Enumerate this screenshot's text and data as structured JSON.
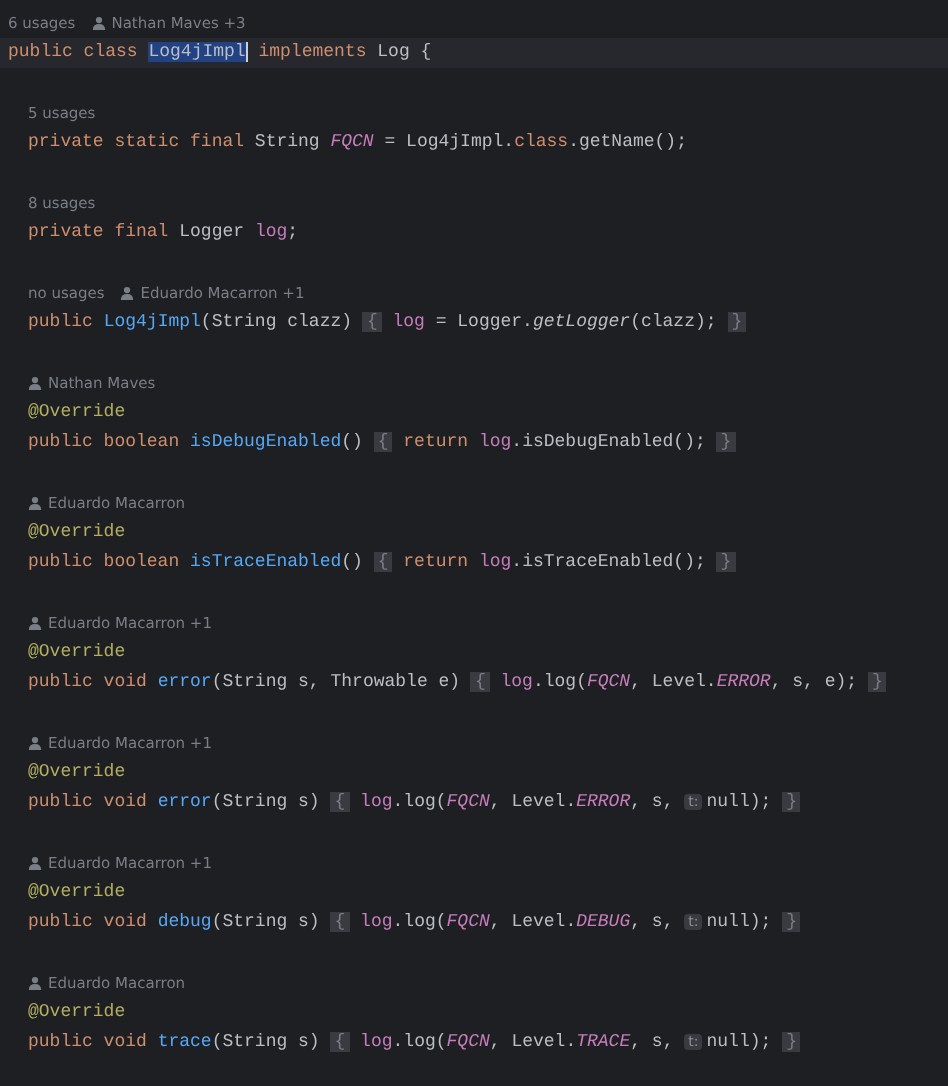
{
  "blocks": [
    {
      "usages": "6 usages",
      "author": "Nathan Maves +3",
      "indent": false,
      "current_line": true,
      "lines": [
        [
          {
            "text": "public class ",
            "kind": "kw"
          },
          {
            "text": "Log4jImpl",
            "kind": "selected"
          },
          {
            "text": " implements ",
            "kind": "kw"
          },
          {
            "text": "Log {",
            "kind": "plain"
          }
        ]
      ]
    },
    {
      "usages": "5 usages",
      "indent": true,
      "lines": [
        [
          {
            "text": "private static final ",
            "kind": "kw"
          },
          {
            "text": "String ",
            "kind": "plain"
          },
          {
            "text": "FQCN",
            "kind": "const"
          },
          {
            "text": " = Log4jImpl.",
            "kind": "plain"
          },
          {
            "text": "class",
            "kind": "kw"
          },
          {
            "text": ".getName();",
            "kind": "plain"
          }
        ]
      ]
    },
    {
      "usages": "8 usages",
      "indent": true,
      "lines": [
        [
          {
            "text": "private final ",
            "kind": "kw"
          },
          {
            "text": "Logger ",
            "kind": "plain"
          },
          {
            "text": "log",
            "kind": "field"
          },
          {
            "text": ";",
            "kind": "plain"
          }
        ]
      ]
    },
    {
      "usages": "no usages",
      "author": "Eduardo Macarron +1",
      "indent": true,
      "lines": [
        [
          {
            "text": "public ",
            "kind": "kw"
          },
          {
            "text": "Log4jImpl",
            "kind": "fn"
          },
          {
            "text": "(String clazz) ",
            "kind": "plain"
          },
          {
            "text": "{",
            "kind": "fold"
          },
          {
            "text": " log",
            "kind": "field"
          },
          {
            "text": " = Logger.",
            "kind": "plain"
          },
          {
            "text": "getLogger",
            "kind": "static"
          },
          {
            "text": "(clazz); ",
            "kind": "plain"
          },
          {
            "text": "}",
            "kind": "fold"
          }
        ]
      ]
    },
    {
      "author": "Nathan Maves",
      "indent": true,
      "lines": [
        [
          {
            "text": "@Override",
            "kind": "annotation"
          }
        ],
        [
          {
            "text": "public boolean ",
            "kind": "kw"
          },
          {
            "text": "isDebugEnabled",
            "kind": "fn"
          },
          {
            "text": "() ",
            "kind": "plain"
          },
          {
            "text": "{",
            "kind": "fold"
          },
          {
            "text": " return ",
            "kind": "kw"
          },
          {
            "text": "log",
            "kind": "field"
          },
          {
            "text": ".isDebugEnabled(); ",
            "kind": "plain"
          },
          {
            "text": "}",
            "kind": "fold"
          }
        ]
      ]
    },
    {
      "author": "Eduardo Macarron",
      "indent": true,
      "lines": [
        [
          {
            "text": "@Override",
            "kind": "annotation"
          }
        ],
        [
          {
            "text": "public boolean ",
            "kind": "kw"
          },
          {
            "text": "isTraceEnabled",
            "kind": "fn"
          },
          {
            "text": "() ",
            "kind": "plain"
          },
          {
            "text": "{",
            "kind": "fold"
          },
          {
            "text": " return ",
            "kind": "kw"
          },
          {
            "text": "log",
            "kind": "field"
          },
          {
            "text": ".isTraceEnabled(); ",
            "kind": "plain"
          },
          {
            "text": "}",
            "kind": "fold"
          }
        ]
      ]
    },
    {
      "author": "Eduardo Macarron +1",
      "indent": true,
      "lines": [
        [
          {
            "text": "@Override",
            "kind": "annotation"
          }
        ],
        [
          {
            "text": "public void ",
            "kind": "kw"
          },
          {
            "text": "error",
            "kind": "fn"
          },
          {
            "text": "(String s, Throwable e) ",
            "kind": "plain"
          },
          {
            "text": "{",
            "kind": "fold"
          },
          {
            "text": " log",
            "kind": "field"
          },
          {
            "text": ".log(",
            "kind": "plain"
          },
          {
            "text": "FQCN",
            "kind": "const"
          },
          {
            "text": ", Level.",
            "kind": "plain"
          },
          {
            "text": "ERROR",
            "kind": "const"
          },
          {
            "text": ", s, e); ",
            "kind": "plain"
          },
          {
            "text": "}",
            "kind": "fold"
          }
        ]
      ]
    },
    {
      "author": "Eduardo Macarron +1",
      "indent": true,
      "lines": [
        [
          {
            "text": "@Override",
            "kind": "annotation"
          }
        ],
        [
          {
            "text": "public void ",
            "kind": "kw"
          },
          {
            "text": "error",
            "kind": "fn"
          },
          {
            "text": "(String s) ",
            "kind": "plain"
          },
          {
            "text": "{",
            "kind": "fold"
          },
          {
            "text": " log",
            "kind": "field"
          },
          {
            "text": ".log(",
            "kind": "plain"
          },
          {
            "text": "FQCN",
            "kind": "const"
          },
          {
            "text": ", Level.",
            "kind": "plain"
          },
          {
            "text": "ERROR",
            "kind": "const"
          },
          {
            "text": ", s, ",
            "kind": "plain"
          },
          {
            "text": "t:",
            "kind": "param"
          },
          {
            "text": "null); ",
            "kind": "plain"
          },
          {
            "text": "}",
            "kind": "fold"
          }
        ]
      ]
    },
    {
      "author": "Eduardo Macarron +1",
      "indent": true,
      "lines": [
        [
          {
            "text": "@Override",
            "kind": "annotation"
          }
        ],
        [
          {
            "text": "public void ",
            "kind": "kw"
          },
          {
            "text": "debug",
            "kind": "fn"
          },
          {
            "text": "(String s) ",
            "kind": "plain"
          },
          {
            "text": "{",
            "kind": "fold"
          },
          {
            "text": " log",
            "kind": "field"
          },
          {
            "text": ".log(",
            "kind": "plain"
          },
          {
            "text": "FQCN",
            "kind": "const"
          },
          {
            "text": ", Level.",
            "kind": "plain"
          },
          {
            "text": "DEBUG",
            "kind": "const"
          },
          {
            "text": ", s, ",
            "kind": "plain"
          },
          {
            "text": "t:",
            "kind": "param"
          },
          {
            "text": "null); ",
            "kind": "plain"
          },
          {
            "text": "}",
            "kind": "fold"
          }
        ]
      ]
    },
    {
      "author": "Eduardo Macarron",
      "indent": true,
      "lines": [
        [
          {
            "text": "@Override",
            "kind": "annotation"
          }
        ],
        [
          {
            "text": "public void ",
            "kind": "kw"
          },
          {
            "text": "trace",
            "kind": "fn"
          },
          {
            "text": "(String s) ",
            "kind": "plain"
          },
          {
            "text": "{",
            "kind": "fold"
          },
          {
            "text": " log",
            "kind": "field"
          },
          {
            "text": ".log(",
            "kind": "plain"
          },
          {
            "text": "FQCN",
            "kind": "const"
          },
          {
            "text": ", Level.",
            "kind": "plain"
          },
          {
            "text": "TRACE",
            "kind": "const"
          },
          {
            "text": ", s, ",
            "kind": "plain"
          },
          {
            "text": "t:",
            "kind": "param"
          },
          {
            "text": "null); ",
            "kind": "plain"
          },
          {
            "text": "}",
            "kind": "fold"
          }
        ]
      ]
    }
  ]
}
